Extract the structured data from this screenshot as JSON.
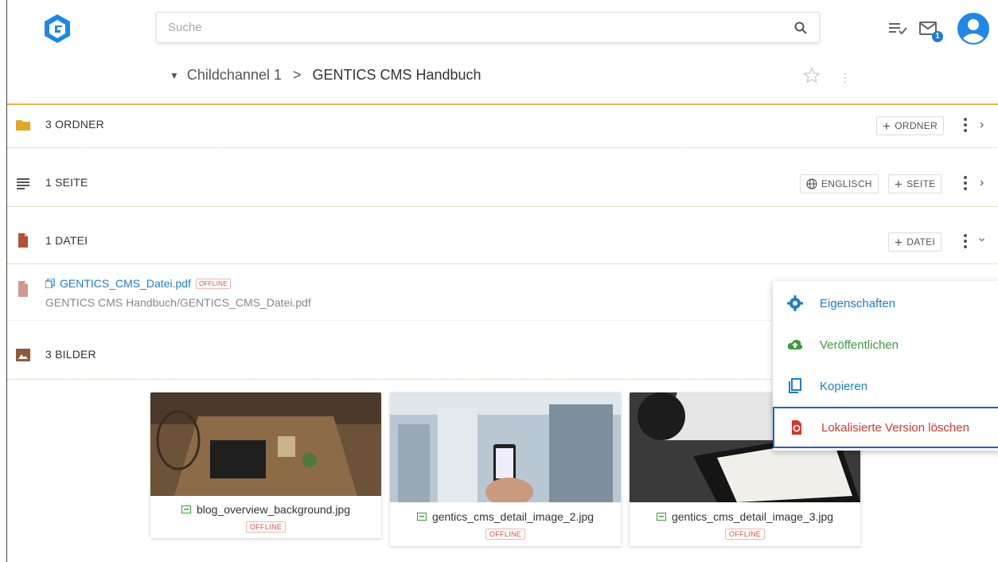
{
  "header": {
    "search_placeholder": "Suche",
    "messages_badge": "1"
  },
  "breadcrumb": {
    "parent": "Childchannel 1",
    "separator": ">",
    "current": "GENTICS CMS Handbuch"
  },
  "sections": {
    "folders": {
      "title": "3 ORDNER",
      "add_label": "ORDNER"
    },
    "pages": {
      "title": "1 SEITE",
      "language_label": "ENGLISCH",
      "add_label": "SEITE"
    },
    "files": {
      "title": "1 DATEI",
      "add_label": "DATEI"
    },
    "images": {
      "title": "3 BILDER"
    }
  },
  "file": {
    "name": "GENTICS_CMS_Datei.pdf",
    "status": "OFFLINE",
    "path": "GENTICS CMS Handbuch/GENTICS_CMS_Datei.pdf"
  },
  "context_menu": {
    "items": [
      {
        "label": "Eigenschaften",
        "color": "#1e7ec8"
      },
      {
        "label": "Veröffentlichen",
        "color": "#3d9a3d"
      },
      {
        "label": "Kopieren",
        "color": "#1e7ec8"
      },
      {
        "label": "Lokalisierte Version löschen",
        "color": "#d9342b"
      }
    ]
  },
  "images": [
    {
      "name": "blog_overview_background.jpg",
      "status": "OFFLINE"
    },
    {
      "name": "gentics_cms_detail_image_2.jpg",
      "status": "OFFLINE"
    },
    {
      "name": "gentics_cms_detail_image_3.jpg",
      "status": "OFFLINE"
    }
  ],
  "colors": {
    "accent_gold": "#e8b64a",
    "link_blue": "#1e7ec8",
    "offline_red": "#e04b3c",
    "selection_border": "#1f5fd4"
  }
}
